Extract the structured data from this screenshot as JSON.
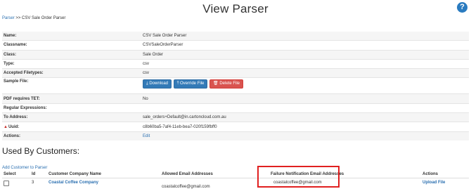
{
  "page": {
    "title": "View Parser"
  },
  "breadcrumb": {
    "link": "Parser",
    "separator": ">>",
    "current": "CSV Sale Order Parser"
  },
  "details": {
    "rows": [
      {
        "label": "Name:",
        "value": "CSV Sale Order Parser"
      },
      {
        "label": "Classname:",
        "value": "CSVSaleOrderParser"
      },
      {
        "label": "Class:",
        "value": "Sale Order"
      },
      {
        "label": "Type:",
        "value": "csv"
      },
      {
        "label": "Accepted Filetypes:",
        "value": "csv"
      }
    ],
    "sample_file": {
      "label": "Sample File:",
      "download": "Download",
      "override": "Override File",
      "delete": "Delete File"
    },
    "rows2": [
      {
        "label": "PDF requires TET:",
        "value": "No"
      },
      {
        "label": "Regular Expressions:",
        "value": ""
      },
      {
        "label": "To Address:",
        "value": "sale_orders+Default@in.cartoncloud.com.au"
      }
    ],
    "uuid": {
      "label": "Uuid:",
      "value": "c8b60ba5-7af4-11eb-bea7-020f159fbff0"
    },
    "actions": {
      "label": "Actions:",
      "edit": "Edit"
    }
  },
  "customers": {
    "title": "Used By Customers:",
    "add_link": "Add Customer to Parser",
    "headers": [
      "Select",
      "Id",
      "Customer Company Name",
      "Allowed Email Addresses",
      "Failure Notification Email Addresses",
      "Actions"
    ],
    "rows": [
      {
        "id": "3",
        "company": "Coastal Coffee Company",
        "allowed_email": "coastalcoffee@gmail.com",
        "failure_email": "coastalcoffee@gmail.com",
        "action": "Upload File"
      }
    ]
  },
  "colors": {
    "accent": "#2a6fb0",
    "danger": "#d9534f",
    "highlight": "#e02020"
  },
  "icons": {
    "help": "question-circle-icon",
    "download": "download-icon",
    "upload": "upload-icon",
    "trash": "trash-icon",
    "warning": "warning-icon"
  }
}
